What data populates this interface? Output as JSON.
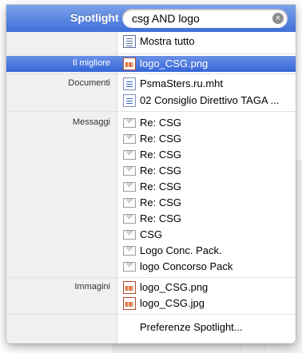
{
  "header": {
    "title": "Spotlight",
    "query": "csg AND logo"
  },
  "top": {
    "show_all": "Mostra tutto"
  },
  "best": {
    "category": "Il migliore",
    "item": "logo_CSG.png"
  },
  "documents": {
    "category": "Documenti",
    "items": [
      "PsmaSters.ru.mht",
      "02 Consiglio Direttivo TAGA ..."
    ]
  },
  "messages": {
    "category": "Messaggi",
    "items": [
      "Re: CSG",
      "Re: CSG",
      "Re: CSG",
      "Re: CSG",
      "Re: CSG",
      "Re: CSG",
      "Re: CSG",
      "CSG",
      "Logo Conc. Pack.",
      "logo Concorso  Pack"
    ]
  },
  "images": {
    "category": "Immagini",
    "items": [
      "logo_CSG.png",
      "logo_CSG.jpg"
    ]
  },
  "footer": {
    "preferences": "Preferenze Spotlight..."
  },
  "icons": {
    "clear": "clear-search-icon",
    "list": "list-icon",
    "image": "image-file-icon",
    "document": "document-icon",
    "mail": "mail-icon"
  },
  "colors": {
    "header": "#3f6fd9",
    "selection": "#3466d8"
  }
}
